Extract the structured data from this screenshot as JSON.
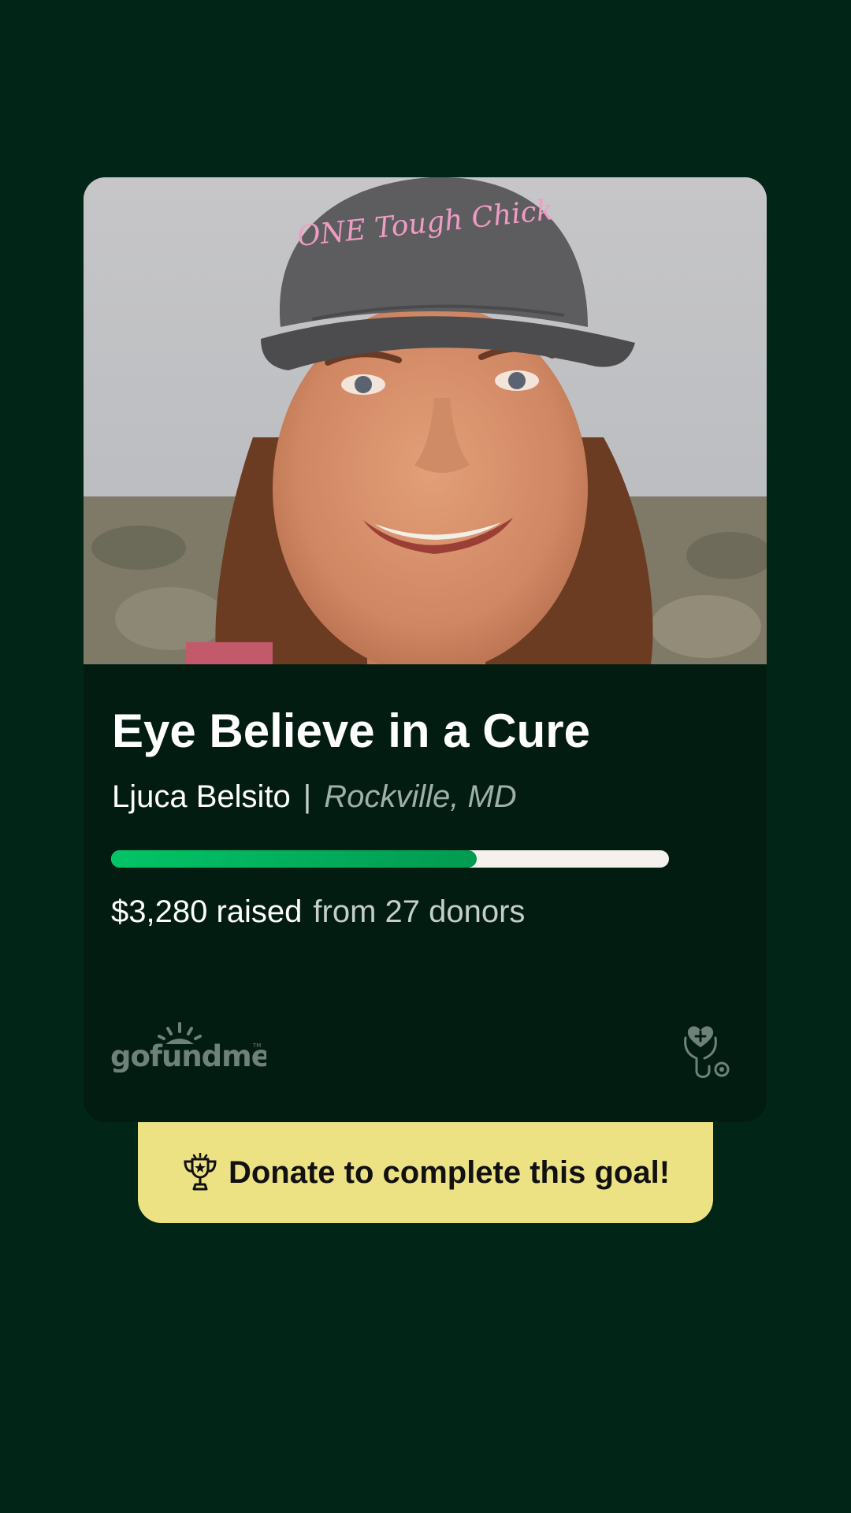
{
  "campaign": {
    "title": "Eye Believe in a Cure",
    "organizer": "Ljuca Belsito",
    "separator": "|",
    "location": "Rockville, MD",
    "raised_text": "$3,280 raised",
    "donors_text": "from 27 donors",
    "progress_fraction": 0.655,
    "photo_hat_text": "ONE Tough Chick"
  },
  "brand": {
    "logo_text": "gofundme",
    "category_icon": "heart-stethoscope-icon"
  },
  "cta": {
    "label": "Donate to complete this goal!",
    "icon": "trophy-icon"
  },
  "colors": {
    "background": "#012617",
    "card": "#021c11",
    "progress_fill": "#02c466",
    "progress_track": "#f5f1ec",
    "cta_background": "#ede283"
  }
}
